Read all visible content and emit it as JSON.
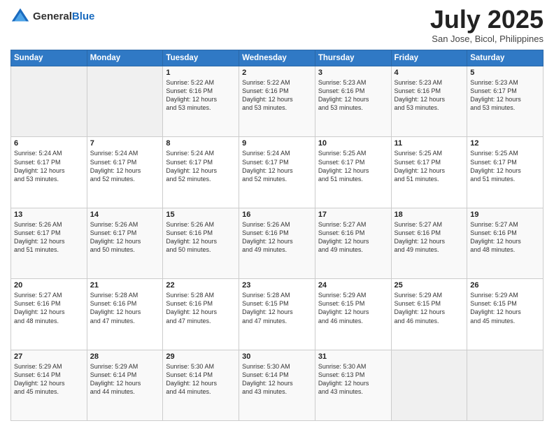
{
  "header": {
    "logo_general": "General",
    "logo_blue": "Blue",
    "month_title": "July 2025",
    "location": "San Jose, Bicol, Philippines"
  },
  "days_of_week": [
    "Sunday",
    "Monday",
    "Tuesday",
    "Wednesday",
    "Thursday",
    "Friday",
    "Saturday"
  ],
  "weeks": [
    [
      {
        "day": "",
        "info": ""
      },
      {
        "day": "",
        "info": ""
      },
      {
        "day": "1",
        "info": "Sunrise: 5:22 AM\nSunset: 6:16 PM\nDaylight: 12 hours\nand 53 minutes."
      },
      {
        "day": "2",
        "info": "Sunrise: 5:22 AM\nSunset: 6:16 PM\nDaylight: 12 hours\nand 53 minutes."
      },
      {
        "day": "3",
        "info": "Sunrise: 5:23 AM\nSunset: 6:16 PM\nDaylight: 12 hours\nand 53 minutes."
      },
      {
        "day": "4",
        "info": "Sunrise: 5:23 AM\nSunset: 6:16 PM\nDaylight: 12 hours\nand 53 minutes."
      },
      {
        "day": "5",
        "info": "Sunrise: 5:23 AM\nSunset: 6:17 PM\nDaylight: 12 hours\nand 53 minutes."
      }
    ],
    [
      {
        "day": "6",
        "info": "Sunrise: 5:24 AM\nSunset: 6:17 PM\nDaylight: 12 hours\nand 53 minutes."
      },
      {
        "day": "7",
        "info": "Sunrise: 5:24 AM\nSunset: 6:17 PM\nDaylight: 12 hours\nand 52 minutes."
      },
      {
        "day": "8",
        "info": "Sunrise: 5:24 AM\nSunset: 6:17 PM\nDaylight: 12 hours\nand 52 minutes."
      },
      {
        "day": "9",
        "info": "Sunrise: 5:24 AM\nSunset: 6:17 PM\nDaylight: 12 hours\nand 52 minutes."
      },
      {
        "day": "10",
        "info": "Sunrise: 5:25 AM\nSunset: 6:17 PM\nDaylight: 12 hours\nand 51 minutes."
      },
      {
        "day": "11",
        "info": "Sunrise: 5:25 AM\nSunset: 6:17 PM\nDaylight: 12 hours\nand 51 minutes."
      },
      {
        "day": "12",
        "info": "Sunrise: 5:25 AM\nSunset: 6:17 PM\nDaylight: 12 hours\nand 51 minutes."
      }
    ],
    [
      {
        "day": "13",
        "info": "Sunrise: 5:26 AM\nSunset: 6:17 PM\nDaylight: 12 hours\nand 51 minutes."
      },
      {
        "day": "14",
        "info": "Sunrise: 5:26 AM\nSunset: 6:17 PM\nDaylight: 12 hours\nand 50 minutes."
      },
      {
        "day": "15",
        "info": "Sunrise: 5:26 AM\nSunset: 6:16 PM\nDaylight: 12 hours\nand 50 minutes."
      },
      {
        "day": "16",
        "info": "Sunrise: 5:26 AM\nSunset: 6:16 PM\nDaylight: 12 hours\nand 49 minutes."
      },
      {
        "day": "17",
        "info": "Sunrise: 5:27 AM\nSunset: 6:16 PM\nDaylight: 12 hours\nand 49 minutes."
      },
      {
        "day": "18",
        "info": "Sunrise: 5:27 AM\nSunset: 6:16 PM\nDaylight: 12 hours\nand 49 minutes."
      },
      {
        "day": "19",
        "info": "Sunrise: 5:27 AM\nSunset: 6:16 PM\nDaylight: 12 hours\nand 48 minutes."
      }
    ],
    [
      {
        "day": "20",
        "info": "Sunrise: 5:27 AM\nSunset: 6:16 PM\nDaylight: 12 hours\nand 48 minutes."
      },
      {
        "day": "21",
        "info": "Sunrise: 5:28 AM\nSunset: 6:16 PM\nDaylight: 12 hours\nand 47 minutes."
      },
      {
        "day": "22",
        "info": "Sunrise: 5:28 AM\nSunset: 6:16 PM\nDaylight: 12 hours\nand 47 minutes."
      },
      {
        "day": "23",
        "info": "Sunrise: 5:28 AM\nSunset: 6:15 PM\nDaylight: 12 hours\nand 47 minutes."
      },
      {
        "day": "24",
        "info": "Sunrise: 5:29 AM\nSunset: 6:15 PM\nDaylight: 12 hours\nand 46 minutes."
      },
      {
        "day": "25",
        "info": "Sunrise: 5:29 AM\nSunset: 6:15 PM\nDaylight: 12 hours\nand 46 minutes."
      },
      {
        "day": "26",
        "info": "Sunrise: 5:29 AM\nSunset: 6:15 PM\nDaylight: 12 hours\nand 45 minutes."
      }
    ],
    [
      {
        "day": "27",
        "info": "Sunrise: 5:29 AM\nSunset: 6:14 PM\nDaylight: 12 hours\nand 45 minutes."
      },
      {
        "day": "28",
        "info": "Sunrise: 5:29 AM\nSunset: 6:14 PM\nDaylight: 12 hours\nand 44 minutes."
      },
      {
        "day": "29",
        "info": "Sunrise: 5:30 AM\nSunset: 6:14 PM\nDaylight: 12 hours\nand 44 minutes."
      },
      {
        "day": "30",
        "info": "Sunrise: 5:30 AM\nSunset: 6:14 PM\nDaylight: 12 hours\nand 43 minutes."
      },
      {
        "day": "31",
        "info": "Sunrise: 5:30 AM\nSunset: 6:13 PM\nDaylight: 12 hours\nand 43 minutes."
      },
      {
        "day": "",
        "info": ""
      },
      {
        "day": "",
        "info": ""
      }
    ]
  ]
}
